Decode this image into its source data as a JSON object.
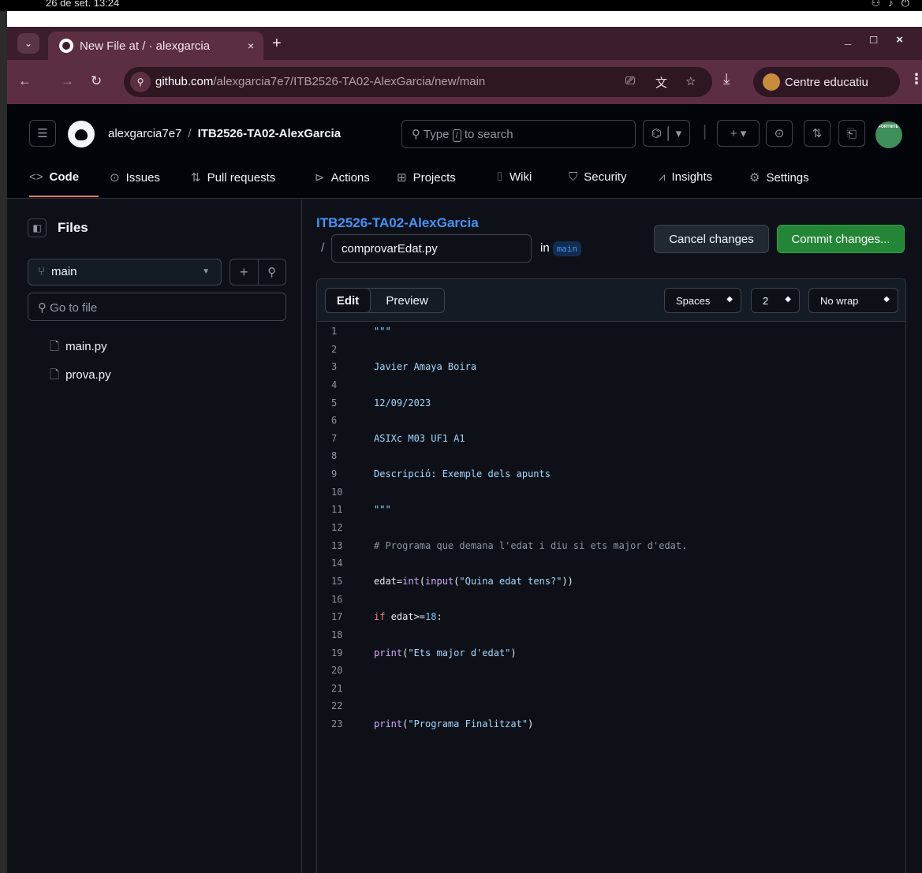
{
  "os": {
    "clock": "26 de set. 13:24"
  },
  "browser": {
    "tab_title": "New File at / · alexgarcia",
    "tab_close": "×",
    "new_tab": "+",
    "url_host": "github.com",
    "url_path": "/alexgarcia7e7/ITB2526-TA02-AlexGarcia/new/main",
    "profile_label": "Centre educatiu"
  },
  "github": {
    "owner": "alexgarcia7e7",
    "repo": "ITB2526-TA02-AlexGarcia",
    "search_prefix": "Type",
    "search_key": "/",
    "search_suffix": "to search",
    "nav": [
      "Code",
      "Issues",
      "Pull requests",
      "Actions",
      "Projects",
      "Wiki",
      "Security",
      "Insights",
      "Settings"
    ],
    "active_tab": "Code"
  },
  "sidebar": {
    "title": "Files",
    "branch": "main",
    "goto_placeholder": "Go to file",
    "files": [
      "main.py",
      "prova.py"
    ]
  },
  "editor": {
    "repo_link": "ITB2526-TA02-AlexGarcia",
    "path_sep": "/",
    "filename": "comprovarEdat.py",
    "in_label": "in",
    "branch": "main",
    "cancel_label": "Cancel changes",
    "commit_label": "Commit changes...",
    "edit_label": "Edit",
    "preview_label": "Preview",
    "indent_mode": "Spaces",
    "indent_size": "2",
    "wrap_mode": "No wrap",
    "lines": [
      {
        "n": "1",
        "segs": [
          {
            "t": "\"\"\"",
            "c": "str"
          }
        ]
      },
      {
        "n": "2",
        "segs": []
      },
      {
        "n": "3",
        "segs": [
          {
            "t": "Javier Amaya Boira",
            "c": "str"
          }
        ]
      },
      {
        "n": "4",
        "segs": []
      },
      {
        "n": "5",
        "segs": [
          {
            "t": "12/09/2023",
            "c": "str"
          }
        ]
      },
      {
        "n": "6",
        "segs": []
      },
      {
        "n": "7",
        "segs": [
          {
            "t": "ASIXc M03 UF1 A1",
            "c": "str"
          }
        ]
      },
      {
        "n": "8",
        "segs": []
      },
      {
        "n": "9",
        "segs": [
          {
            "t": "Descripció: Exemple dels apunts",
            "c": "str"
          }
        ]
      },
      {
        "n": "10",
        "segs": []
      },
      {
        "n": "11",
        "segs": [
          {
            "t": "\"\"\"",
            "c": "str"
          }
        ]
      },
      {
        "n": "12",
        "segs": []
      },
      {
        "n": "13",
        "segs": [
          {
            "t": "# Programa que demana l'edat i diu si ets major d'edat.",
            "c": "com"
          }
        ]
      },
      {
        "n": "14",
        "segs": []
      },
      {
        "n": "15",
        "segs": [
          {
            "t": "edat=",
            "c": "plain"
          },
          {
            "t": "int",
            "c": "fn"
          },
          {
            "t": "(",
            "c": "plain"
          },
          {
            "t": "input",
            "c": "fn"
          },
          {
            "t": "(",
            "c": "plain"
          },
          {
            "t": "\"Quina edat tens?\"",
            "c": "str"
          },
          {
            "t": "))",
            "c": "plain"
          }
        ]
      },
      {
        "n": "16",
        "segs": []
      },
      {
        "n": "17",
        "segs": [
          {
            "t": "if",
            "c": "kw"
          },
          {
            "t": " edat>=",
            "c": "plain"
          },
          {
            "t": "18",
            "c": "num"
          },
          {
            "t": ":",
            "c": "plain"
          }
        ]
      },
      {
        "n": "18",
        "segs": []
      },
      {
        "n": "19",
        "segs": [
          {
            "t": "print",
            "c": "fn"
          },
          {
            "t": "(",
            "c": "plain"
          },
          {
            "t": "\"Ets major d'edat\"",
            "c": "str"
          },
          {
            "t": ")",
            "c": "plain"
          }
        ]
      },
      {
        "n": "20",
        "segs": []
      },
      {
        "n": "21",
        "segs": []
      },
      {
        "n": "22",
        "segs": []
      },
      {
        "n": "23",
        "segs": [
          {
            "t": "print",
            "c": "fn"
          },
          {
            "t": "(",
            "c": "plain"
          },
          {
            "t": "\"Programa Finalitzat\"",
            "c": "str"
          },
          {
            "t": ")",
            "c": "plain"
          }
        ]
      }
    ]
  },
  "colors": {
    "accent_blue": "#4493f8",
    "commit_green": "#238636",
    "active_tab_underline": "#f78166",
    "browser_frame": "#5c2e44"
  }
}
